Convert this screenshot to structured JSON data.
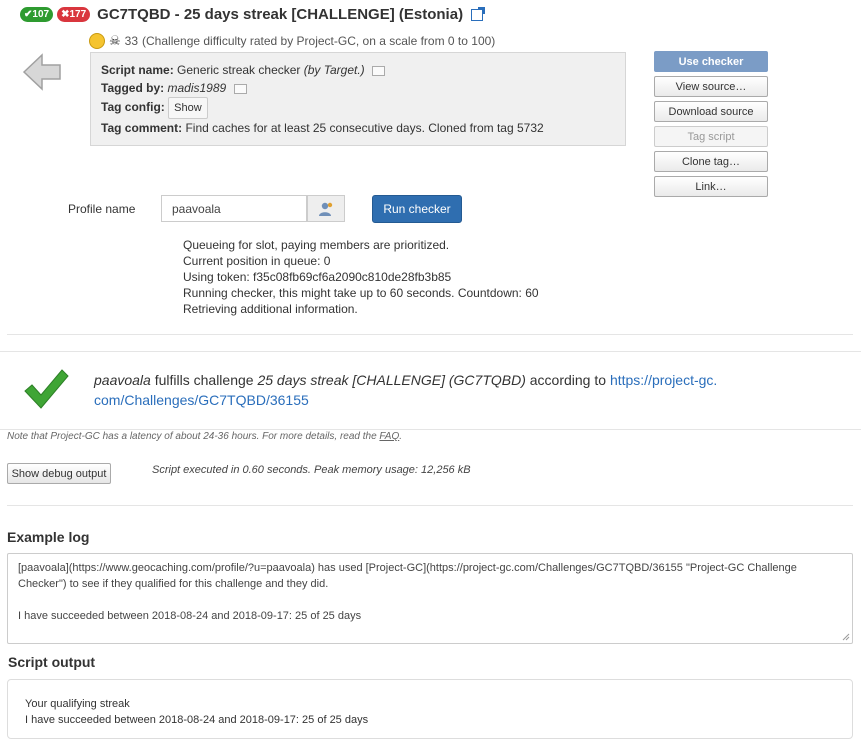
{
  "header": {
    "found_count": "107",
    "dnf_count": "177",
    "title": "GC7TQBD - 25 days streak [CHALLENGE] (Estonia)"
  },
  "difficulty": {
    "value": "33",
    "note": "(Challenge difficulty rated by Project-GC, on a scale from 0 to 100)"
  },
  "script_info": {
    "name_label": "Script name:",
    "name_value": "Generic streak checker",
    "name_by": "(by Target.)",
    "tagged_label": "Tagged by:",
    "tagged_value": "madis1989",
    "tagconfig_label": "Tag config:",
    "show_label": "Show",
    "comment_label": "Tag comment:",
    "comment_value": "Find caches for at least 25 consecutive days. Cloned from tag 5732"
  },
  "side_buttons": [
    "Use checker",
    "View source…",
    "Download source",
    "Tag script",
    "Clone tag…",
    "Link…"
  ],
  "profile": {
    "label": "Profile name",
    "value": "paavoala",
    "run_label": "Run checker"
  },
  "queue_lines": [
    "Queueing for slot, paying members are prioritized.",
    "Current position in queue: 0",
    "Using token: f35c08fb69cf6a2090c810de28fb3b85",
    "Running checker, this might take up to 60 seconds. Countdown: 60",
    "Retrieving additional information."
  ],
  "result": {
    "user": "paavoala",
    "text1": "fulfills challenge",
    "challenge": "25 days streak [CHALLENGE] (GC7TQBD)",
    "text2": "according to",
    "link": "https://project-gc.com/Challenges/GC7TQBD/36155"
  },
  "latency": {
    "text": "Note that Project-GC has a latency of about 24-36 hours. For more details, read the",
    "faq": "FAQ",
    "end": "."
  },
  "debug": {
    "button": "Show debug output",
    "exec": "Script executed in 0.60 seconds. Peak memory usage: 12,256 kB"
  },
  "example_log": {
    "heading": "Example log",
    "line1": "[paavoala](https://www.geocaching.com/profile/?u=paavoala) has used [Project-GC](https://project-gc.com/Challenges/GC7TQBD/36155 \"Project-GC Challenge Checker\") to see if they qualified for this challenge and they did.",
    "line2": "I have succeeded between 2018-08-24 and 2018-09-17: 25 of 25 days"
  },
  "script_output": {
    "heading": "Script output",
    "line1": "Your qualifying streak",
    "line2": "I have succeeded between 2018-08-24 and 2018-09-17: 25 of 25 days"
  },
  "colors": {
    "primary": "#2f6eb0",
    "found": "#2e9b30",
    "dnf": "#d9363e",
    "check": "#3fa535"
  }
}
